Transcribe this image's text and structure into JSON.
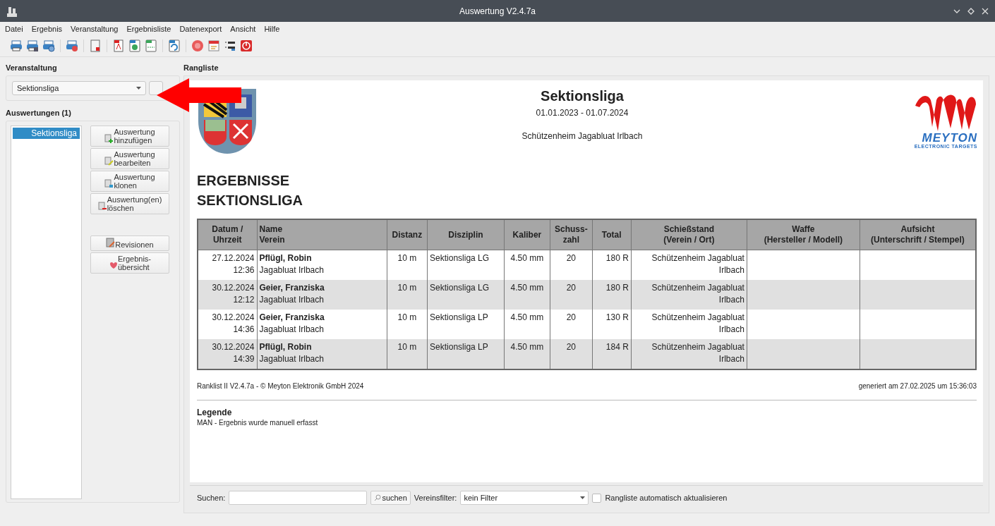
{
  "window": {
    "title": "Auswertung V2.4.7a"
  },
  "menu": [
    "Datei",
    "Ergebnis",
    "Veranstaltung",
    "Ergebnisliste",
    "Datenexport",
    "Ansicht",
    "Hilfe"
  ],
  "sidebar": {
    "event_label": "Veranstaltung",
    "event_select": "Sektionsliga",
    "evaluations_label": "Auswertungen (1)",
    "evaluations": [
      {
        "label": "Sektionsliga",
        "selected": true
      }
    ],
    "actions": [
      {
        "kind": "add",
        "label": "Auswertung\nhinzufügen"
      },
      {
        "kind": "edit",
        "label": "Auswertung\nbearbeiten"
      },
      {
        "kind": "clone",
        "label": "Auswertung\nklonen"
      },
      {
        "kind": "delete",
        "label": "Auswertung(en)\nlöschen"
      }
    ],
    "extra_actions": [
      {
        "kind": "revisions",
        "label": "Revisionen"
      },
      {
        "kind": "overview",
        "label": "Ergebnis-\nübersicht"
      }
    ]
  },
  "ranking_label": "Rangliste",
  "report": {
    "title": "Sektionsliga",
    "period": "01.01.2023 - 01.07.2024",
    "venue": "Schützenheim Jagabluat Irlbach",
    "logo": {
      "name": "MEYTON",
      "tagline": "ELECTRONIC TARGETS"
    },
    "heading": "ERGEBNISSE\nSEKTIONSLIGA",
    "table": {
      "columns": [
        {
          "label": "Datum /\nUhrzeit"
        },
        {
          "label": "Name\nVerein"
        },
        {
          "label": "Distanz"
        },
        {
          "label": "Disziplin"
        },
        {
          "label": "Kaliber"
        },
        {
          "label": "Schuss-\nzahl"
        },
        {
          "label": "Total"
        },
        {
          "label": "Schießstand\n(Verein / Ort)"
        },
        {
          "label": "Waffe\n(Hersteller / Modell)"
        },
        {
          "label": "Aufsicht\n(Unterschrift / Stempel)"
        }
      ],
      "rows": [
        {
          "date": "27.12.2024",
          "time": "12:36",
          "name": "Pflügl, Robin",
          "club": "Jagabluat Irlbach",
          "distance": "10 m",
          "discipline": "Sektionsliga LG",
          "caliber": "4.50 mm",
          "shots": "20",
          "total": "180 R",
          "range": "Schützenheim Jagabluat Irlbach"
        },
        {
          "date": "30.12.2024",
          "time": "12:12",
          "name": "Geier, Franziska",
          "club": "Jagabluat Irlbach",
          "distance": "10 m",
          "discipline": "Sektionsliga LG",
          "caliber": "4.50 mm",
          "shots": "20",
          "total": "180 R",
          "range": "Schützenheim Jagabluat Irlbach"
        },
        {
          "date": "30.12.2024",
          "time": "14:36",
          "name": "Geier, Franziska",
          "club": "Jagabluat Irlbach",
          "distance": "10 m",
          "discipline": "Sektionsliga LP",
          "caliber": "4.50 mm",
          "shots": "20",
          "total": "130 R",
          "range": "Schützenheim Jagabluat Irlbach"
        },
        {
          "date": "30.12.2024",
          "time": "14:39",
          "name": "Pflügl, Robin",
          "club": "Jagabluat Irlbach",
          "distance": "10 m",
          "discipline": "Sektionsliga LP",
          "caliber": "4.50 mm",
          "shots": "20",
          "total": "184 R",
          "range": "Schützenheim Jagabluat Irlbach"
        }
      ]
    },
    "footer_left": "Ranklist II V2.4.7a - © Meyton Elektronik GmbH 2024",
    "footer_right": "generiert am 27.02.2025 um 15:36:03",
    "legend_title": "Legende",
    "legend_text": "MAN - Ergebnis wurde manuell erfasst"
  },
  "search_bar": {
    "search_label": "Suchen:",
    "search_button": "suchen",
    "filter_label": "Vereinsfilter:",
    "filter_value": "kein Filter",
    "auto_update": {
      "label": "Rangliste automatisch aktualisieren",
      "checked": false
    }
  }
}
